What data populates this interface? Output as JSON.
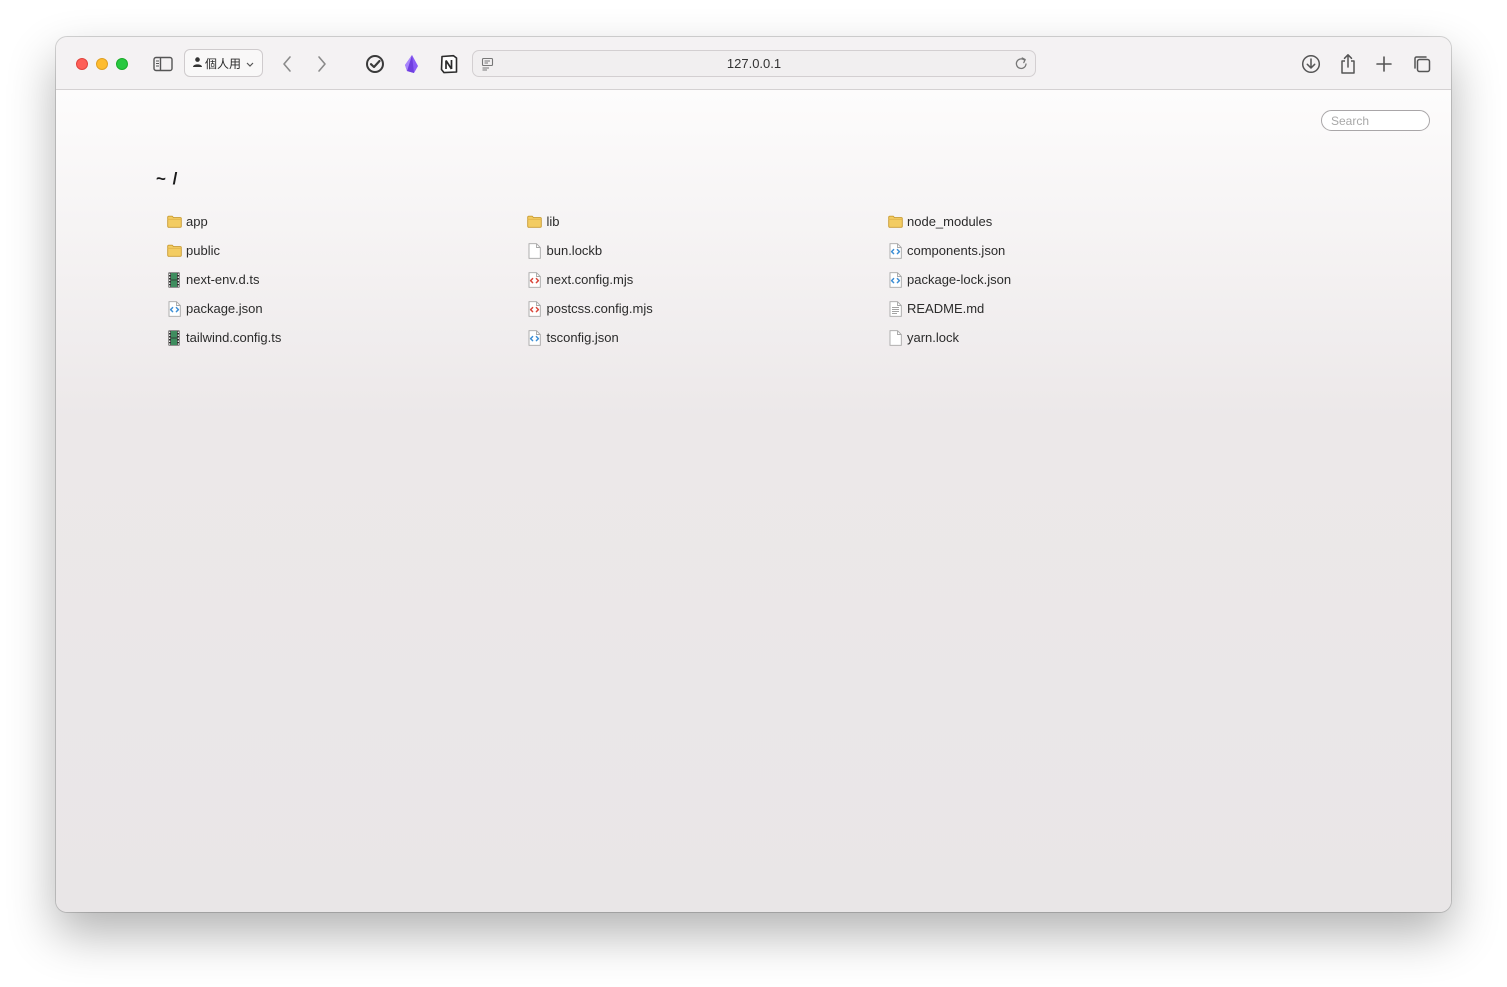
{
  "toolbar": {
    "profile_label": "個人用",
    "address": "127.0.0.1"
  },
  "content": {
    "search_placeholder": "Search",
    "breadcrumb": "~ /",
    "files": [
      {
        "name": "app",
        "icon": "folder-icon"
      },
      {
        "name": "lib",
        "icon": "folder-icon"
      },
      {
        "name": "node_modules",
        "icon": "folder-icon"
      },
      {
        "name": "public",
        "icon": "folder-icon"
      },
      {
        "name": "bun.lockb",
        "icon": "blank-file-icon"
      },
      {
        "name": "components.json",
        "icon": "json-file-icon"
      },
      {
        "name": "next-env.d.ts",
        "icon": "film-file-icon"
      },
      {
        "name": "next.config.mjs",
        "icon": "script-file-icon"
      },
      {
        "name": "package-lock.json",
        "icon": "json-file-icon"
      },
      {
        "name": "package.json",
        "icon": "json-file-icon"
      },
      {
        "name": "postcss.config.mjs",
        "icon": "script-file-icon"
      },
      {
        "name": "README.md",
        "icon": "text-file-icon"
      },
      {
        "name": "tailwind.config.ts",
        "icon": "film-file-icon"
      },
      {
        "name": "tsconfig.json",
        "icon": "json-file-icon"
      },
      {
        "name": "yarn.lock",
        "icon": "blank-file-icon"
      }
    ]
  },
  "colors": {
    "close": "#fe5f57",
    "minimize": "#febc2e",
    "maximize": "#28c840",
    "folder": "#f3cc62",
    "json_icon": "#3d8fd6",
    "script_icon": "#d9463a",
    "film_icon": "#3f8d5f"
  }
}
